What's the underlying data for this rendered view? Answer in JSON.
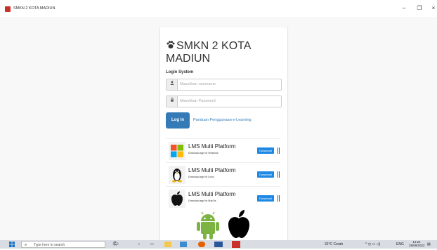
{
  "window": {
    "title": "SMKN 2 KOTA MADIUN",
    "controls": {
      "minimize": "–",
      "maximize": "❐",
      "close": "×"
    }
  },
  "brand": {
    "text": "SMKN 2 KOTA MADIUN",
    "icon": "paw-icon"
  },
  "login": {
    "subtitle": "Login System",
    "username_placeholder": "Masukkan username",
    "password_placeholder": "Masukkan Password",
    "login_label": "Log In",
    "guide_link": "Panduan Penggunaan e-Learning"
  },
  "downloads": [
    {
      "title": "LMS Multi Platform",
      "subtitle": "Download app for Windows",
      "button": "Download",
      "icon": "windows-icon"
    },
    {
      "title": "LMS Multi Platform",
      "subtitle": "Download app for Linux",
      "button": "Download",
      "icon": "linux-icon"
    },
    {
      "title": "LMS Multi Platform",
      "subtitle": "Download app for MacOs",
      "button": "Download",
      "icon": "apple-icon"
    }
  ],
  "platforms": {
    "android": "android-icon",
    "apple": "apple-icon"
  },
  "taskbar": {
    "search_placeholder": "Type here to search",
    "weather": "32°C Cerah",
    "language": "ENG",
    "time": "12:21",
    "date": "28/09/2022"
  },
  "colors": {
    "primary": "#337ab7",
    "download": "#1e88e5",
    "app_icon": "#c9302c"
  }
}
